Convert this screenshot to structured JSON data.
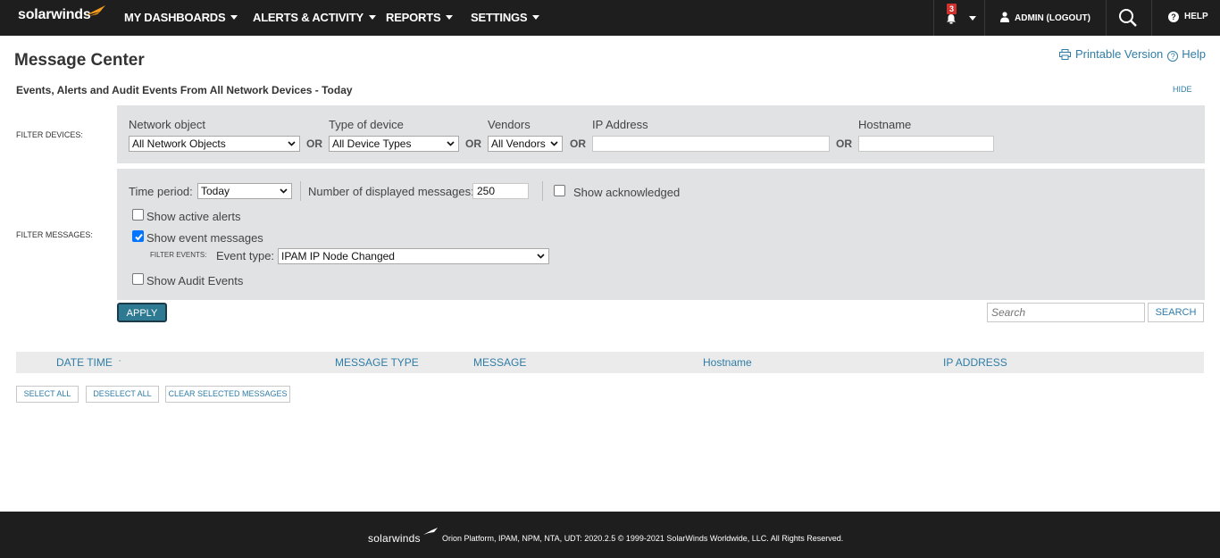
{
  "brand": {
    "logo_text": "solarwinds",
    "accent_color": "#f99d1c"
  },
  "nav": {
    "items": [
      {
        "label": "MY DASHBOARDS"
      },
      {
        "label": "ALERTS & ACTIVITY"
      },
      {
        "label": "REPORTS"
      },
      {
        "label": "SETTINGS"
      }
    ],
    "notification_count": "3",
    "user_label": "ADMIN (LOGOUT)",
    "help_label": "HELP"
  },
  "page": {
    "title": "Message Center",
    "printable_label": "Printable Version",
    "help_label": "Help",
    "subtitle": "Events, Alerts and Audit Events From All Network Devices - Today",
    "hide_label": "HIDE"
  },
  "filter_devices": {
    "label": "FILTER DEVICES:",
    "network_object": {
      "label": "Network object",
      "value": "All Network Objects"
    },
    "device_type": {
      "label": "Type of device",
      "value": "All Device Types"
    },
    "vendors": {
      "label": "Vendors",
      "value": "All Vendors"
    },
    "ip_address": {
      "label": "IP Address",
      "value": ""
    },
    "hostname": {
      "label": "Hostname",
      "value": ""
    },
    "or_label": "OR"
  },
  "filter_messages": {
    "label": "FILTER MESSAGES:",
    "time_period": {
      "label": "Time period:",
      "value": "Today"
    },
    "num_messages": {
      "label": "Number of displayed messages:",
      "value": "250"
    },
    "show_acknowledged": {
      "label": "Show acknowledged",
      "checked": false
    },
    "show_active_alerts": {
      "label": "Show active alerts",
      "checked": false
    },
    "show_event_messages": {
      "label": "Show event messages",
      "checked": true
    },
    "filter_events_label": "FILTER EVENTS:",
    "event_type": {
      "label": "Event type:",
      "value": "IPAM IP Node Changed"
    },
    "show_audit_events": {
      "label": "Show Audit Events",
      "checked": false
    }
  },
  "actions": {
    "apply_label": "APPLY",
    "search_placeholder": "Search",
    "search_button": "SEARCH"
  },
  "table": {
    "columns": [
      "DATE TIME",
      "MESSAGE TYPE",
      "MESSAGE",
      "Hostname",
      "IP ADDRESS"
    ]
  },
  "table_actions": {
    "select_all": "SELECT ALL",
    "deselect_all": "DESELECT ALL",
    "clear_selected": "CLEAR SELECTED MESSAGES"
  },
  "footer": {
    "logo_text": "solarwinds",
    "text": "Orion Platform, IPAM, NPM, NTA, UDT: 2020.2.5 © 1999-2021 SolarWinds Worldwide, LLC. All Rights Reserved."
  }
}
